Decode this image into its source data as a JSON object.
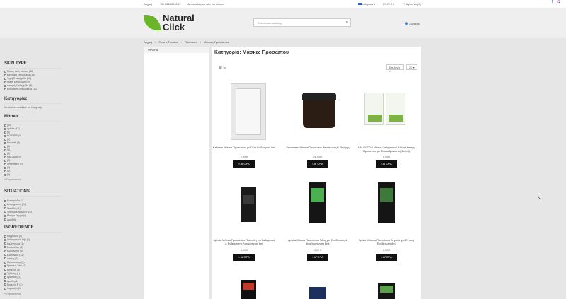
{
  "topbar": {
    "links": [
      "Αρχική",
      "+30 2665024037",
      "Αποστολές σε όλο τον κόσμο"
    ],
    "language": "ελληνικά",
    "currency": "EUR €",
    "wishlist": "Αγαπ/να (0)",
    "social": [
      "facebook-icon",
      "instagram-icon"
    ]
  },
  "header": {
    "logo_line1": "Natural",
    "logo_line2": "Click",
    "search_placeholder": "Search our catalog",
    "account": "Σύνδεση"
  },
  "breadcrumb": [
    "Αρχική",
    "Για την Γυναίκα",
    "Πρόσωπο",
    "Μάσκες Προσώπου"
  ],
  "sidebar": {
    "filters_title": "ΦΙΛΤΡΑ",
    "skin_type": {
      "title": "SKIN TYPE",
      "items": [
        "Όλους τους τύπους (16)",
        "Κανονική επιδερμίδα (10)",
        "Ξηρή Επιδερμίδα (10)",
        "Μικτή Επιδερμίδα (9)",
        "Λιπαρή Επιδερμίδα (8)",
        "Ευαίσθητη Επιδερμίδα (11)"
      ]
    },
    "categories": {
      "title": "Κατηγορίες",
      "note": "No choices available on this group"
    },
    "brand": {
      "title": "Μάρκα",
      "items": [
        "(10)",
        "Apivita (12)",
        "(1)",
        "KORRES (3)",
        "(6)",
        "Bioearth (1)",
        "(1)",
        "(1)",
        "(1)",
        "MALAMA (3)",
        "(2)",
        "Seventeen (2)",
        "(1)",
        "(1)",
        "(1)"
      ],
      "more": "+ Περισσότερα"
    },
    "situations": {
      "title": "SITUATIONS",
      "items": [
        "Κυτταρίτιδα (1)",
        "Αντιγήρανση (24)",
        "Πανάδες (1)",
        "Ξηρή Αφυδάτωση (10)",
        "Μαύρα Στίγμα (4)",
        "Ακμή (6)"
      ]
    },
    "ingredience": {
      "title": "INGREDIENCE",
      "items": [
        "Κάρβουνο (4)",
        "Υαλουρονικό Οξύ (1)",
        "Καλέντουλα (1)",
        "Σπιρουλίνα (1)",
        "Κολλαγόνο (1)",
        "Ελαιόλαδο (12)",
        "Δάφνη (1)",
        "Μελισσόκερι (1)",
        "Πράσινο Τσάι (4)",
        "Βιταμίνη (1)",
        "Τζίντζερ (1)",
        "Προπόλη (1)",
        "Αργίλη (1)",
        "Βιταμίνη Ε (1)",
        "Χαμομήλι (1)"
      ],
      "more": "+ Περισσότερα"
    }
  },
  "main": {
    "category_title": "Κατηγορία: Μάσκες Προσώπου",
    "sort_label": "Επιλογή",
    "per_page": "20",
    "buy_label": "ΑΓΟΡΑ",
    "products": [
      {
        "name": "Kalliston Μάσκα Προσώπου με Γάλα Γαϊδουριού 8ml",
        "price": "2,90 €"
      },
      {
        "name": "Seventeen Μάσκα Προσώπου Ανανέωσης & Θρέψης",
        "price": "26,00 €"
      },
      {
        "name": "KALLISTON Μάσκα Καθαρισμού & Απολέπισης Προσώπου με Έλαιο Αβοκάντο (2x6ml)",
        "price": "4,00 €"
      },
      {
        "name": "Apivita Μάσκα Προσώπου Πρόπολη για Καθαρισμό & Ρύθμιση της Λιπαρότητας 8ml",
        "price": "4,00 €"
      },
      {
        "name": "Apivita Μάσκα Προσώπου Αλόη για Ενυδάτωση & Αναζωογόνηση 8ml",
        "price": "4,00 €"
      },
      {
        "name": "Apivita Μάσκα Προσώπου Αγγούρι για Έντονη Ενυδάτωση 8ml",
        "price": "4,00 €"
      }
    ]
  }
}
